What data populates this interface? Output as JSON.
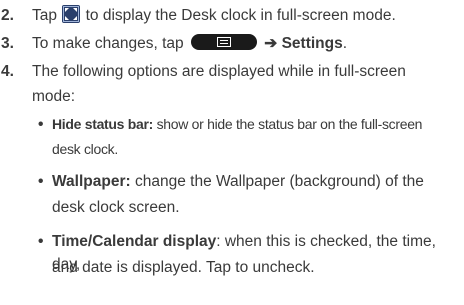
{
  "steps": [
    {
      "number": "2.",
      "pre": "Tap",
      "post": "to display the Desk clock in full-screen mode."
    },
    {
      "number": "3.",
      "pre": "To make changes, tap",
      "arrow": "➔",
      "post_bold": "Settings",
      "post_end": "."
    },
    {
      "number": "4.",
      "line1": "The following options are displayed while in full-screen",
      "line2": "mode:"
    }
  ],
  "bullets": [
    {
      "term": "Hide status bar:",
      "desc_line1": "show or hide the status bar on the full-screen",
      "desc_line2": "desk clock."
    },
    {
      "term": "Wallpaper:",
      "desc_line1": "change the Wallpaper (background) of the",
      "desc_line2": "desk clock screen."
    },
    {
      "term": "Time/Calendar display",
      "desc_line1": ": when this is checked, the time, day,",
      "desc_line2": "and date is displayed. Tap to uncheck."
    }
  ],
  "bullet_char": "•",
  "icons": {
    "fullscreen": "fullscreen-icon",
    "menu": "menu-key-icon"
  },
  "colors": {
    "text": "#3a3a3a",
    "icon_bg": "#2a3f6b",
    "menu_key": "#1a1a1a"
  }
}
